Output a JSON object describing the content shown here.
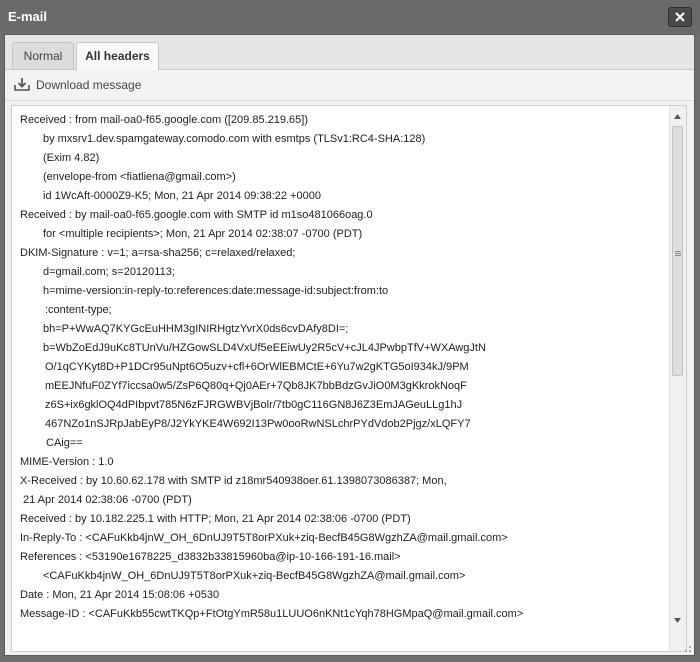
{
  "window": {
    "title": "E-mail",
    "close_icon": "close-icon"
  },
  "tabs": [
    {
      "label": "Normal",
      "active": false
    },
    {
      "label": "All headers",
      "active": true
    }
  ],
  "toolbar": {
    "download_label": "Download message",
    "download_icon": "download-icon"
  },
  "headers": [
    "Received : from mail-oa0-f65.google.com ([209.85.219.65])",
    "by mxsrv1.dev.spamgateway.comodo.com with esmtps (TLSv1:RC4-SHA:128)",
    "(Exim 4.82)",
    "(envelope-from <fiatliena@gmail.com>)",
    "id 1WcAft-0000Z9-K5; Mon, 21 Apr 2014 09:38:22 +0000",
    "Received : by mail-oa0-f65.google.com with SMTP id m1so481066oag.0",
    "for <multiple recipients>; Mon, 21 Apr 2014 02:38:07 -0700 (PDT)",
    "DKIM-Signature : v=1; a=rsa-sha256; c=relaxed/relaxed;",
    "d=gmail.com; s=20120113;",
    "h=mime-version:in-reply-to:references:date:message-id:subject:from:to",
    ":content-type;",
    "bh=P+WwAQ7KYGcEuHHM3gINIRHgtzYvrX0ds6cvDAfy8DI=;",
    "b=WbZoEdJ9uKc8TUnVu/HZGowSLD4VxUf5eEEiwUy2R5cV+cJL4JPwbpTfV+WXAwgJtN",
    "O/1qCYKyt8D+P1DCr95uNpt6O5uzv+cfl+6OrWlEBMCtE+6Yu7w2gKTG5oI934kJ/9PM",
    "mEEJNfuF0ZYf7iccsa0w5/ZsP6Q80q+Qj0AEr+7Qb8JK7bbBdzGvJiO0M3gKkrokNoqF",
    "z6S+ix6gklOQ4dPIbpvt785N6zFJRGWBVjBolr/7tb0gC116GN8J6Z3EmJAGeuLLg1hJ",
    "467NZo1nSJRpJabEyP8/J2YkYKE4W692I13Pw0ooRwNSLchrPYdVdob2Pjgz/xLQFY7",
    "CAig==",
    "MIME-Version : 1.0",
    "X-Received : by 10.60.62.178 with SMTP id z18mr540938oer.61.1398073086387; Mon,",
    "21 Apr 2014 02:38:06 -0700 (PDT)",
    "Received : by 10.182.225.1 with HTTP; Mon, 21 Apr 2014 02:38:06 -0700 (PDT)",
    "In-Reply-To : <CAFuKkb4jnW_OH_6DnUJ9T5T8orPXuk+ziq-BecfB45G8WgzhZA@mail.gmail.com>",
    "References : <53190e1678225_d3832b33815960ba@ip-10-166-191-16.mail>",
    "<CAFuKkb4jnW_OH_6DnUJ9T5T8orPXuk+ziq-BecfB45G8WgzhZA@mail.gmail.com>",
    "Date : Mon, 21 Apr 2014 15:08:06 +0530",
    "Message-ID : <CAFuKkb55cwtTKQp+FtOtgYmR58u1LUUO6nKNt1cYqh78HGMpaQ@mail.gmail.com>"
  ]
}
